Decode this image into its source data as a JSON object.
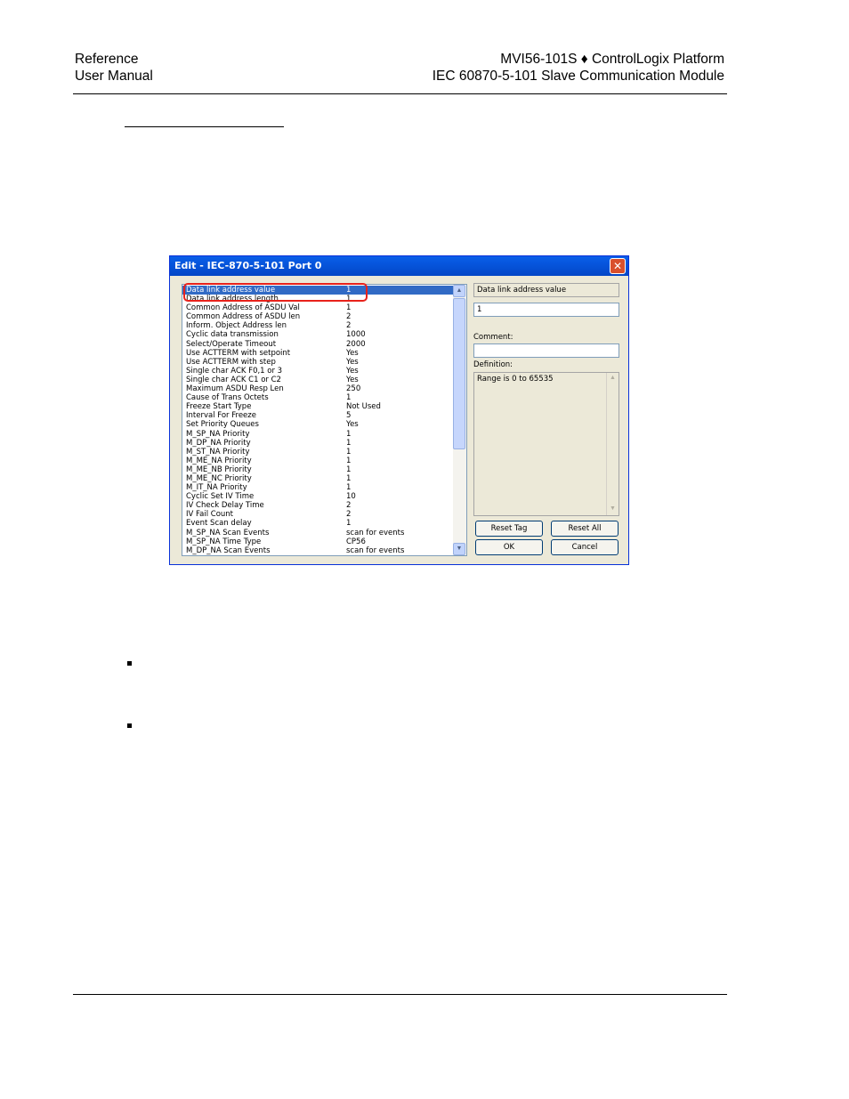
{
  "header": {
    "left_line1": "Reference",
    "left_line2": "User Manual",
    "right_line1": "MVI56-101S ♦ ControlLogix Platform",
    "right_line2": "IEC 60870-5-101 Slave Communication Module"
  },
  "dialog": {
    "title": "Edit - IEC-870-5-101 Port 0",
    "close_glyph": "✕",
    "items": [
      {
        "name": "Data link address value",
        "value": "1",
        "selected": true
      },
      {
        "name": "Data link address length",
        "value": "1"
      },
      {
        "name": "Common Address of ASDU Val",
        "value": "1"
      },
      {
        "name": "Common Address of ASDU len",
        "value": "2"
      },
      {
        "name": "Inform. Object Address len",
        "value": "2"
      },
      {
        "name": "Cyclic data transmission",
        "value": "1000"
      },
      {
        "name": "Select/Operate Timeout",
        "value": "2000"
      },
      {
        "name": "Use ACTTERM with setpoint",
        "value": "Yes"
      },
      {
        "name": "Use ACTTERM with step",
        "value": "Yes"
      },
      {
        "name": "Single char ACK F0,1 or 3",
        "value": "Yes"
      },
      {
        "name": "Single char ACK C1 or C2",
        "value": "Yes"
      },
      {
        "name": "Maximum ASDU Resp Len",
        "value": "250"
      },
      {
        "name": "Cause of Trans Octets",
        "value": "1"
      },
      {
        "name": "Freeze Start Type",
        "value": "Not Used"
      },
      {
        "name": "Interval For Freeze",
        "value": "5"
      },
      {
        "name": "Set Priority Queues",
        "value": "Yes"
      },
      {
        "name": "M_SP_NA Priority",
        "value": "1"
      },
      {
        "name": "M_DP_NA Priority",
        "value": "1"
      },
      {
        "name": "M_ST_NA Priority",
        "value": "1"
      },
      {
        "name": "M_ME_NA Priority",
        "value": "1"
      },
      {
        "name": "M_ME_NB Priority",
        "value": "1"
      },
      {
        "name": "M_ME_NC Priority",
        "value": "1"
      },
      {
        "name": "M_IT_NA Priority",
        "value": "1"
      },
      {
        "name": "Cyclic Set IV Time",
        "value": "10"
      },
      {
        "name": "IV Check Delay Time",
        "value": "2"
      },
      {
        "name": "IV Fail Count",
        "value": "2"
      },
      {
        "name": "Event Scan delay",
        "value": "1"
      },
      {
        "name": "M_SP_NA Scan Events",
        "value": "scan for events"
      },
      {
        "name": "M_SP_NA Time Type",
        "value": "CP56"
      },
      {
        "name": "M_DP_NA Scan Events",
        "value": "scan for events"
      }
    ],
    "selected_name": "Data link address value",
    "selected_value": "1",
    "comment_label": "Comment:",
    "comment_value": "",
    "definition_label": "Definition:",
    "definition_text": "Range is 0 to 65535",
    "buttons": {
      "reset_tag": "Reset Tag",
      "reset_all": "Reset All",
      "ok": "OK",
      "cancel": "Cancel"
    }
  }
}
